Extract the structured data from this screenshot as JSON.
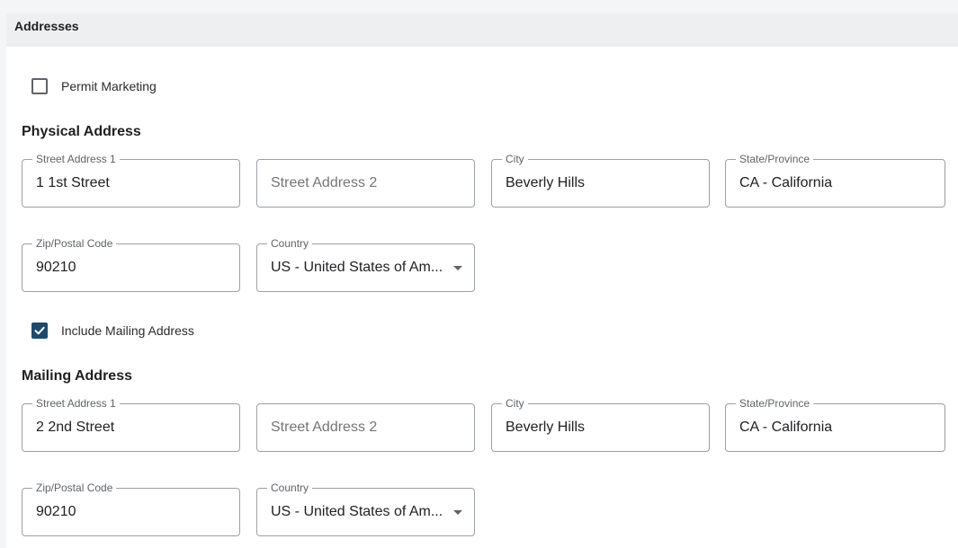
{
  "section": {
    "title": "Addresses"
  },
  "permit_marketing": {
    "label": "Permit Marketing",
    "checked": false
  },
  "physical": {
    "title": "Physical Address",
    "street1": {
      "label": "Street Address 1",
      "value": "1 1st Street"
    },
    "street2": {
      "placeholder": "Street Address 2",
      "value": ""
    },
    "city": {
      "label": "City",
      "value": "Beverly Hills"
    },
    "state": {
      "label": "State/Province",
      "value": "CA - California"
    },
    "zip": {
      "label": "Zip/Postal Code",
      "value": "90210"
    },
    "country": {
      "label": "Country",
      "value": "US - United States of Am..."
    }
  },
  "include_mailing": {
    "label": "Include Mailing Address",
    "checked": true
  },
  "mailing": {
    "title": "Mailing Address",
    "street1": {
      "label": "Street Address 1",
      "value": "2 2nd Street"
    },
    "street2": {
      "placeholder": "Street Address 2",
      "value": ""
    },
    "city": {
      "label": "City",
      "value": "Beverly Hills"
    },
    "state": {
      "label": "State/Province",
      "value": "CA - California"
    },
    "zip": {
      "label": "Zip/Postal Code",
      "value": "90210"
    },
    "country": {
      "label": "Country",
      "value": "US - United States of Am..."
    }
  },
  "colors": {
    "accent": "#1d4a6e",
    "header_bg": "#edeff1",
    "border": "#9aa0a6"
  },
  "icons": {
    "checkmark": "check-icon",
    "dropdown": "caret-down-icon"
  }
}
